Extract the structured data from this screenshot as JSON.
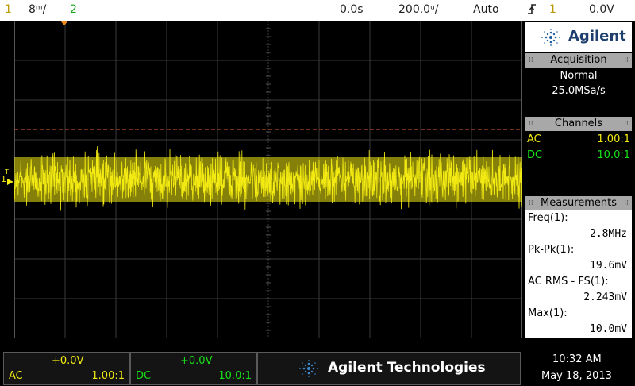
{
  "top": {
    "ch1": "1",
    "ch1_scale": "8ᵐ/",
    "ch2": "2",
    "time_pos": "0.0s",
    "time_div": "200.0ᵘ/",
    "trigger_mode": "Auto",
    "trigger_source": "1",
    "trigger_level": "0.0V"
  },
  "screen": {
    "trigger_label": "T",
    "ch1_label": "1"
  },
  "panel": {
    "brand": "Agilent",
    "acquisition": {
      "title": "Acquisition",
      "mode": "Normal",
      "rate": "25.0MSa/s"
    },
    "channels": {
      "title": "Channels",
      "ch1": {
        "coupling": "AC",
        "probe": "1.00:1"
      },
      "ch2": {
        "coupling": "DC",
        "probe": "10.0:1"
      }
    },
    "measurements": {
      "title": "Measurements",
      "items": [
        {
          "label": "Freq(1):",
          "value": "2.8MHz"
        },
        {
          "label": "Pk-Pk(1):",
          "value": "19.6mV"
        },
        {
          "label": "AC RMS - FS(1):",
          "value": "2.243mV"
        },
        {
          "label": "Max(1):",
          "value": "10.0mV"
        }
      ]
    }
  },
  "bottom": {
    "ch1": {
      "offset": "+0.0V",
      "coupling": "AC",
      "probe": "1.00:1"
    },
    "ch2": {
      "offset": "+0.0V",
      "coupling": "DC",
      "probe": "10.0:1"
    },
    "brand": "Agilent Technologies",
    "time": "10:32 AM",
    "date": "May 18, 2013"
  },
  "colors": {
    "ch1": "#f2ea12",
    "ch2": "#18e018",
    "trigger_line": "#e0602e",
    "grid": "#3a3a3a",
    "brand_blue": "#1f3f6e"
  }
}
